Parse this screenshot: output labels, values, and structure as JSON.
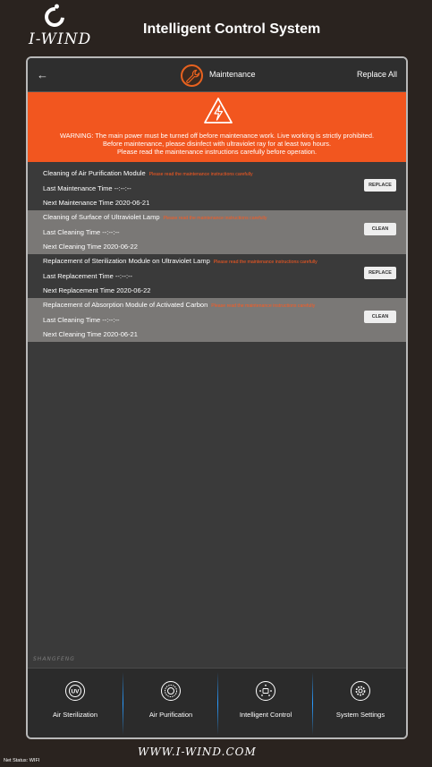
{
  "header": {
    "logo_text": "I-WIND",
    "title": "Intelligent Control System"
  },
  "nav": {
    "back_icon": "arrow-left-icon",
    "title": "Maintenance",
    "replace_all": "Replace All"
  },
  "warning": {
    "icon": "high-voltage-warning-icon",
    "lines": [
      "WARNING: The main power must be turned off before maintenance work. Live working is strictly prohibited.",
      "Before maintenance, please disinfect with ultraviolet ray for at least two hours.",
      "Please read the maintenance instructions carefully before operation."
    ],
    "color": "#f2561f"
  },
  "items": [
    {
      "title": "Cleaning of Air Purification Module",
      "note": "Please read the maintenance instructions carefully",
      "line1": "Last Maintenance Time  --:--:--",
      "line2": "Next Maintenance Time  2020-06-21",
      "button": "REPLACE"
    },
    {
      "title": "Cleaning of Surface of Ultraviolet Lamp",
      "note": "Please read the maintenance instructions carefully",
      "line1": "Last Cleaning Time  --:--:--",
      "line2": "Next Cleaning Time  2020-06-22",
      "button": "CLEAN"
    },
    {
      "title": "Replacement of Sterilization Module on Ultraviolet Lamp",
      "note": "Please read the maintenance instructions carefully",
      "line1": "Last Replacement Time  --:--:--",
      "line2": "Next Replacement Time  2020-06-22",
      "button": "REPLACE"
    },
    {
      "title": "Replacement of Absorption Module of Activated Carbon",
      "note": "Please read the maintenance instructions carefully",
      "line1": "Last Cleaning Time  --:--:--",
      "line2": "Next Cleaning Time  2020-06-21",
      "button": "CLEAN"
    }
  ],
  "brand_mark": "SHANGFENG",
  "bottom_nav": [
    {
      "label": "Air Sterilization",
      "icon": "uv-icon"
    },
    {
      "label": "Air Purification",
      "icon": "purification-icon"
    },
    {
      "label": "Intelligent Control",
      "icon": "intelligent-control-icon"
    },
    {
      "label": "System Settings",
      "icon": "gear-icon"
    }
  ],
  "footer": {
    "website": "WWW.I-WIND.COM",
    "net_status": "Net Status:  WIFI"
  }
}
